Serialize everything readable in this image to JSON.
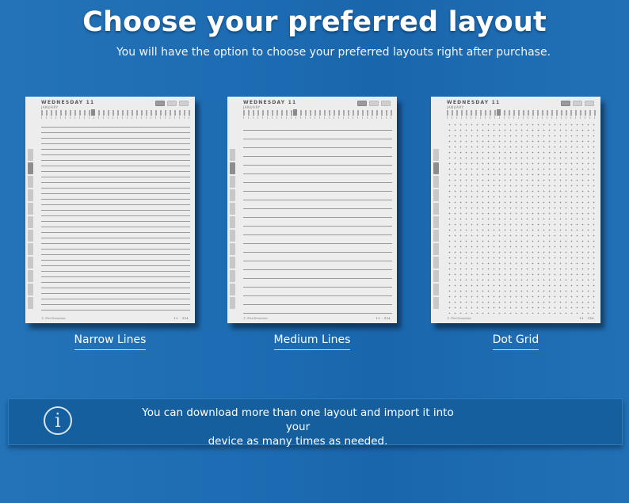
{
  "header": {
    "title": "Choose your preferred layout",
    "subtitle": "You will have the option to choose your preferred layouts right after purchase."
  },
  "layouts": [
    {
      "label": "Narrow Lines",
      "style": "narrow-lines"
    },
    {
      "label": "Medium Lines",
      "style": "medium-lines"
    },
    {
      "label": "Dot Grid",
      "style": "dot-grid"
    }
  ],
  "preview_page": {
    "date": "WEDNESDAY 11",
    "month": "JANUARY",
    "footer_left": "© iPlanTemplates",
    "footer_right": "11 · 334"
  },
  "info": {
    "icon": "info-icon",
    "text_line1": "You can download more than one layout and import it into your",
    "text_line2": "device as many times as needed."
  }
}
